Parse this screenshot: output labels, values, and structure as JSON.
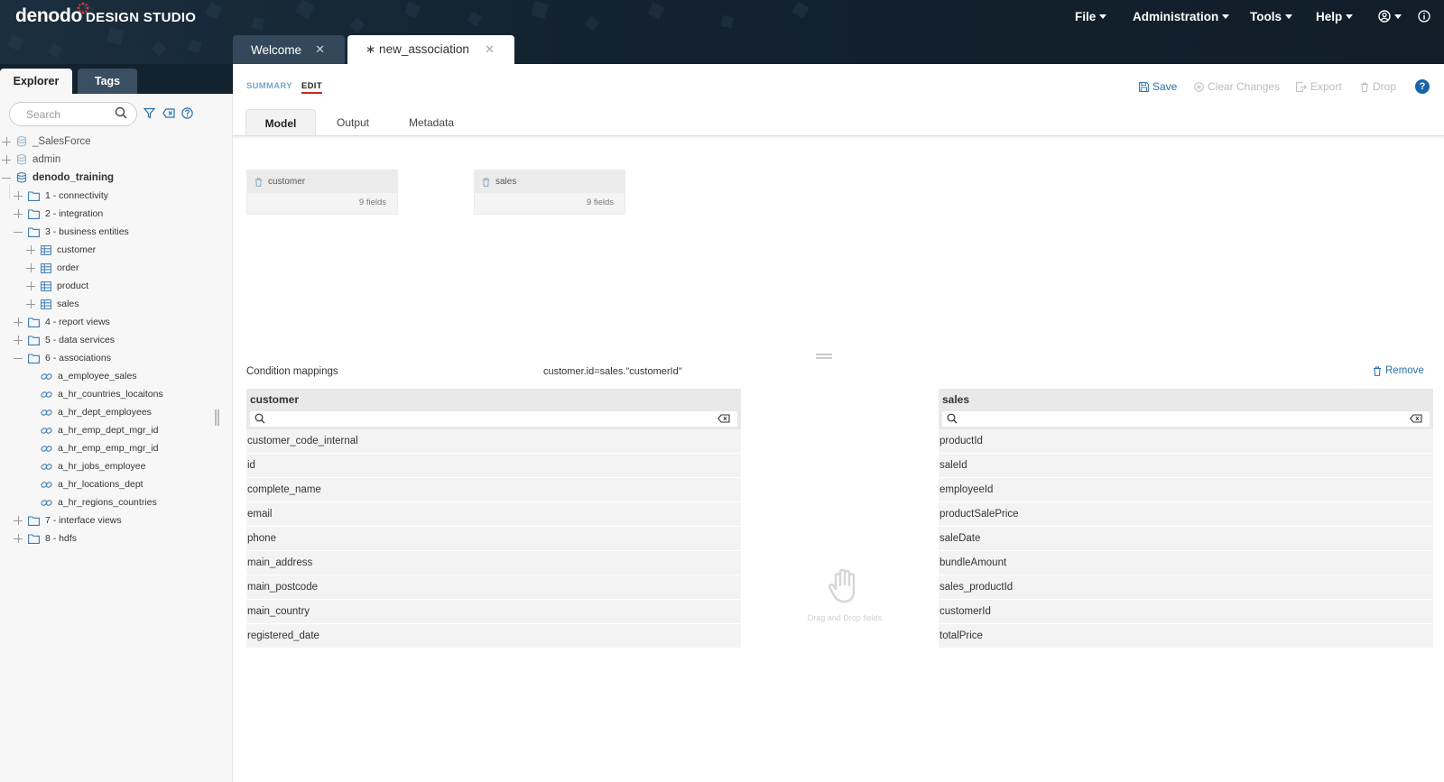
{
  "app": {
    "logo": "denodo",
    "product": "DESIGN STUDIO"
  },
  "menu": {
    "file": "File",
    "administration": "Administration",
    "tools": "Tools",
    "help": "Help"
  },
  "doc_tabs": {
    "welcome": "Welcome",
    "active": "∗ new_association",
    "close_glyph": "✕"
  },
  "sidebar": {
    "tabs": {
      "explorer": "Explorer",
      "tags": "Tags"
    },
    "search_placeholder": "Search",
    "tree": [
      {
        "label": "_SalesForce",
        "type": "database"
      },
      {
        "label": "admin",
        "type": "database"
      },
      {
        "label": "denodo_training",
        "type": "database"
      },
      {
        "label": "1 - connectivity",
        "type": "folder"
      },
      {
        "label": "2 - integration",
        "type": "folder"
      },
      {
        "label": "3 - business entities",
        "type": "folder"
      },
      {
        "label": "customer",
        "type": "view"
      },
      {
        "label": "order",
        "type": "view"
      },
      {
        "label": "product",
        "type": "view"
      },
      {
        "label": "sales",
        "type": "view"
      },
      {
        "label": "4 - report views",
        "type": "folder"
      },
      {
        "label": "5 - data services",
        "type": "folder"
      },
      {
        "label": "6 - associations",
        "type": "folder"
      },
      {
        "label": "a_employee_sales",
        "type": "association"
      },
      {
        "label": "a_hr_countries_locaitons",
        "type": "association"
      },
      {
        "label": "a_hr_dept_employees",
        "type": "association"
      },
      {
        "label": "a_hr_emp_dept_mgr_id",
        "type": "association"
      },
      {
        "label": "a_hr_emp_emp_mgr_id",
        "type": "association"
      },
      {
        "label": "a_hr_jobs_employee",
        "type": "association"
      },
      {
        "label": "a_hr_locations_dept",
        "type": "association"
      },
      {
        "label": "a_hr_regions_countries",
        "type": "association"
      },
      {
        "label": "7 - interface views",
        "type": "folder"
      },
      {
        "label": "8 - hdfs",
        "type": "folder"
      }
    ]
  },
  "editor": {
    "modes": {
      "summary": "SUMMARY",
      "edit": "EDIT"
    },
    "actions": {
      "save": "Save",
      "clear_changes": "Clear Changes",
      "export": "Export",
      "drop": "Drop",
      "help": "?"
    },
    "subtabs": {
      "model": "Model",
      "output": "Output",
      "metadata": "Metadata"
    },
    "views": [
      {
        "name": "customer",
        "fields": "9 fields"
      },
      {
        "name": "sales",
        "fields": "9 fields"
      }
    ],
    "condition": {
      "title": "Condition mappings",
      "expression": "customer.id=sales.\"customerId\"",
      "remove": "Remove"
    },
    "left_panel": {
      "title": "customer",
      "fields": [
        "customer_code_internal",
        "id",
        "complete_name",
        "email",
        "phone",
        "main_address",
        "main_postcode",
        "main_country",
        "registered_date"
      ]
    },
    "right_panel": {
      "title": "sales",
      "fields": [
        "productId",
        "saleId",
        "employeeId",
        "productSalePrice",
        "saleDate",
        "bundleAmount",
        "sales_productId",
        "customerId",
        "totalPrice"
      ]
    },
    "drag_drop_hint": "Drag and Drop fields"
  }
}
